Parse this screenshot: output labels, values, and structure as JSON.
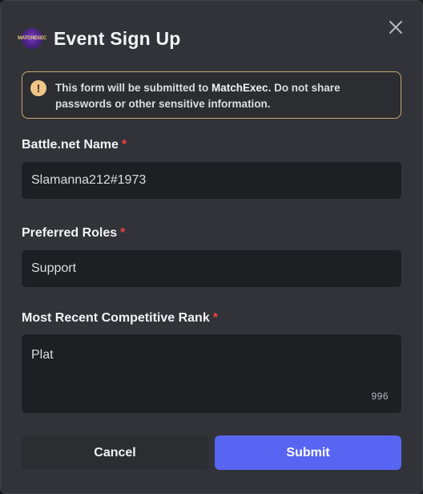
{
  "modal": {
    "title": "Event Sign Up",
    "app_icon_text": "MATCHEXEC"
  },
  "notice": {
    "text_before": "This form will be submitted to ",
    "app_name": "MatchExec",
    "text_after": ". Do not share passwords or other sensitive information.",
    "icon": "exclamation-icon",
    "border_color": "#c8a870"
  },
  "fields": [
    {
      "label": "Battle.net Name",
      "required_mark": "*",
      "value": "Slamanna212#1973"
    },
    {
      "label": "Preferred Roles",
      "required_mark": "*",
      "value": "Support"
    },
    {
      "label": "Most Recent Competitive Rank",
      "required_mark": "*",
      "value": "Plat",
      "remaining_chars": "996"
    }
  ],
  "buttons": {
    "cancel": "Cancel",
    "submit": "Submit",
    "submit_color": "#5865f2"
  }
}
